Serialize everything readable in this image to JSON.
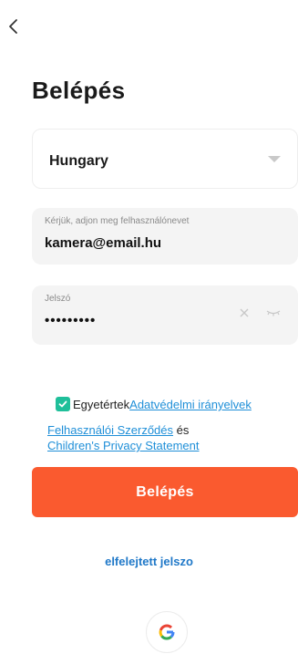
{
  "header": {
    "back_icon": "chevron-left-icon",
    "title": "Belépés"
  },
  "form": {
    "country_value": "Hungary",
    "username_label": "Kérjük, adjon meg felhasználónevet",
    "username_value": "kamera@email.hu",
    "password_label": "Jelszó",
    "password_value": "•••••••••",
    "clear_icon": "close-icon",
    "visibility_icon": "eye-closed-icon"
  },
  "consent": {
    "checked": true,
    "prefix": "Egyetértek",
    "privacy_link": "Adatvédelmi irányelvek",
    "terms_link": "Felhasználói Szerződés",
    "and_text": " és",
    "children_link": "Children's Privacy Statement"
  },
  "actions": {
    "login_label": "Belépés",
    "forgot_label": "elfelejtett jelszo",
    "google_icon": "google-icon"
  },
  "colors": {
    "accent": "#fa5a2f",
    "link": "#1f8fd8",
    "checkbox": "#1fbf9a"
  }
}
